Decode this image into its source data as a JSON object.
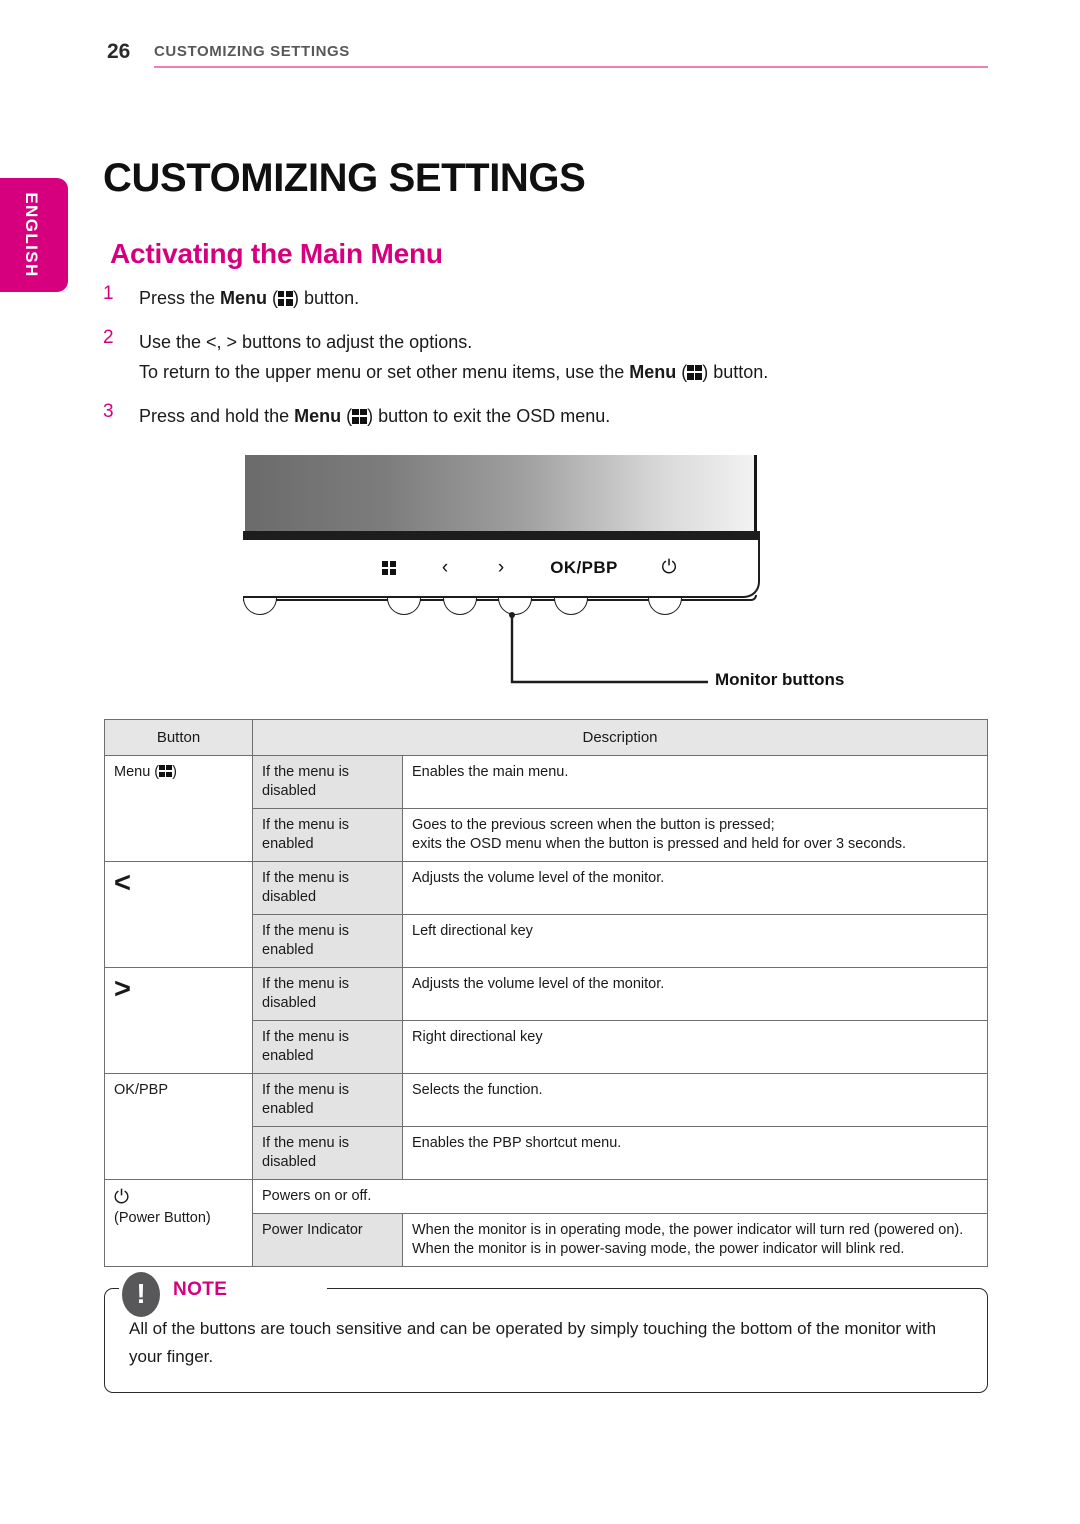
{
  "header": {
    "page_number": "26",
    "chapter_label": "CUSTOMIZING SETTINGS",
    "rule_color": "#ef7fbb"
  },
  "language_tab": {
    "label": "ENGLISH",
    "color": "#d6007f"
  },
  "titles": {
    "chapter": "CUSTOMIZING SETTINGS",
    "section": "Activating the Main Menu",
    "section_color": "#d6007f"
  },
  "steps": [
    {
      "number": "1",
      "lines": [
        {
          "pre": "Press the ",
          "bold": "Menu",
          "mid": " (",
          "icon": "menu-grid-icon",
          "post": ") button."
        }
      ]
    },
    {
      "number": "2",
      "lines": [
        {
          "pre": "Use the <, > buttons to adjust the options.",
          "bold": "",
          "mid": "",
          "icon": "",
          "post": ""
        },
        {
          "pre": "To return to the upper menu or set other menu items, use the ",
          "bold": "Menu",
          "mid": " (",
          "icon": "menu-grid-icon",
          "post": ") button."
        }
      ]
    },
    {
      "number": "3",
      "lines": [
        {
          "pre": "Press and hold the ",
          "bold": "Menu",
          "mid": " (",
          "icon": "menu-grid-icon",
          "post": ")  button to exit the OSD menu."
        }
      ]
    }
  ],
  "figure": {
    "bezel_buttons": [
      {
        "name": "menu-grid-icon",
        "label": ""
      },
      {
        "name": "left-chevron-icon",
        "label": "‹"
      },
      {
        "name": "right-chevron-icon",
        "label": "›"
      },
      {
        "name": "okpbp-button",
        "label": "OK/PBP"
      },
      {
        "name": "power-icon",
        "label": "⏻"
      }
    ],
    "callout_label": "Monitor buttons"
  },
  "table": {
    "headers": [
      "Button",
      "Description"
    ],
    "rows": [
      {
        "button": "Menu (",
        "button_suffix": ")",
        "button_icon": "menu-grid-icon",
        "entries": [
          {
            "condition": "If the menu is disabled",
            "description": "Enables the main menu."
          },
          {
            "condition": "If the menu is enabled",
            "description": "Goes to the previous screen when the button is pressed;\nexits the OSD menu when the button is pressed and held for over 3 seconds."
          }
        ]
      },
      {
        "button": "<",
        "button_icon": "left-arrow-icon",
        "entries": [
          {
            "condition": "If the menu is disabled",
            "description": "Adjusts the volume level of the monitor."
          },
          {
            "condition": "If the menu is enabled",
            "description": "Left directional key"
          }
        ]
      },
      {
        "button": ">",
        "button_icon": "right-arrow-icon",
        "entries": [
          {
            "condition": "If the menu is disabled",
            "description": "Adjusts the volume level of the monitor."
          },
          {
            "condition": "If the menu is enabled",
            "description": "Right directional key"
          }
        ]
      },
      {
        "button": "OK/PBP",
        "button_icon": "",
        "entries": [
          {
            "condition": "If the menu is enabled",
            "description": "Selects the function."
          },
          {
            "condition": "If the menu is disabled",
            "description": "Enables the PBP shortcut menu."
          }
        ]
      },
      {
        "button": "(Power Button)",
        "button_icon": "power-icon",
        "entries": [
          {
            "condition": "",
            "description": "Powers on or off."
          },
          {
            "condition": "Power Indicator",
            "description": "When the monitor is in operating mode, the power indicator will turn red (powered on).\nWhen the monitor is in power-saving mode, the power indicator will blink red."
          }
        ]
      }
    ]
  },
  "note": {
    "title": "NOTE",
    "icon": "exclamation-icon",
    "body": "All of the buttons are touch sensitive and can be operated by simply touching the bottom of the monitor with your finger."
  }
}
